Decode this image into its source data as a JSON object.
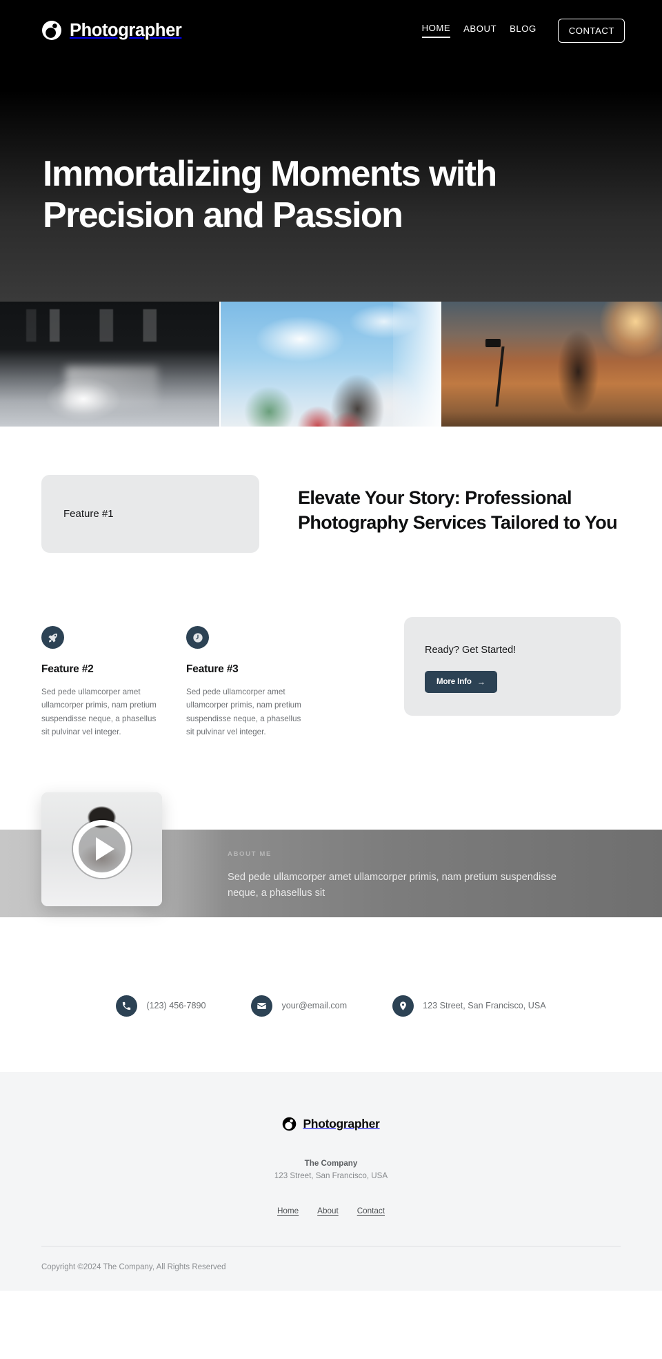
{
  "header": {
    "brand": "Photographer",
    "logo_icon": "aperture-circle-icon",
    "nav": [
      {
        "label": "HOME",
        "active": true
      },
      {
        "label": "ABOUT",
        "active": false
      },
      {
        "label": "BLOG",
        "active": false
      }
    ],
    "cta_label": "CONTACT"
  },
  "hero": {
    "title": "Immortalizing Moments with Precision and Passion",
    "images": [
      {
        "name": "studio-lighting-photo",
        "alt": "Photography studio with lights and white backdrop"
      },
      {
        "name": "wedding-couple-photo",
        "alt": "Wedding couple kissing under blue sky with palm trees"
      },
      {
        "name": "sunset-landscape-photo",
        "alt": "Photographer with tripod on hillside at sunset"
      }
    ]
  },
  "feature_head": {
    "card_label": "Feature #1",
    "heading": "Elevate Your Story: Professional Photography Services Tailored to You"
  },
  "features": [
    {
      "icon": "rocket-icon",
      "title": "Feature #2",
      "body": "Sed pede ullamcorper amet ullamcorper primis, nam pretium suspendisse neque, a phasellus sit pulvinar vel integer."
    },
    {
      "icon": "clock-icon",
      "title": "Feature #3",
      "body": "Sed pede ullamcorper amet ullamcorper primis, nam pretium suspendisse neque, a phasellus sit pulvinar vel integer."
    }
  ],
  "cta": {
    "title": "Ready? Get Started!",
    "button_label": "More Info",
    "button_arrow": "→"
  },
  "about": {
    "kicker": "ABOUT ME",
    "body": "Sed pede ullamcorper amet ullamcorper primis, nam pretium suspendisse neque, a phasellus sit",
    "video_alt": "Photographer holding camera",
    "play_icon": "play-icon"
  },
  "contact": [
    {
      "icon": "phone-icon",
      "text": "(123) 456-7890"
    },
    {
      "icon": "envelope-icon",
      "text": "your@email.com"
    },
    {
      "icon": "map-pin-icon",
      "text": "123 Street, San Francisco, USA"
    }
  ],
  "footer": {
    "brand": "Photographer",
    "logo_icon": "aperture-circle-icon",
    "company": "The Company",
    "address": "123 Street, San Francisco, USA",
    "links": [
      {
        "label": "Home"
      },
      {
        "label": "About"
      },
      {
        "label": "Contact"
      }
    ],
    "copyright": "Copyright ©2024 The Company, All Rights Reserved"
  },
  "colors": {
    "accent_dark": "#2c4254",
    "hero_bg": "#000000",
    "card_bg": "#e8e9ea",
    "footer_bg": "#f4f5f6"
  }
}
